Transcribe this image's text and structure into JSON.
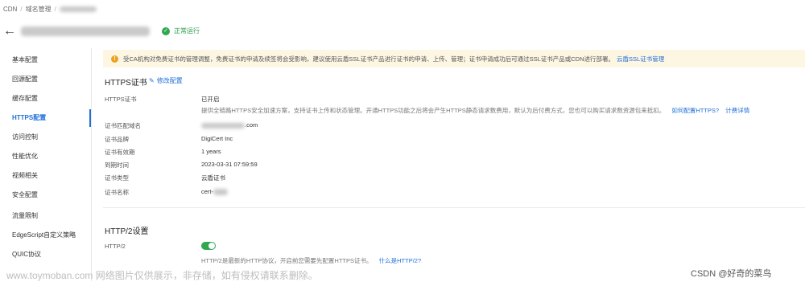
{
  "breadcrumb": {
    "root": "CDN",
    "sep": "/",
    "level1": "域名管理",
    "sep2": "/"
  },
  "header": {
    "status": "正常运行"
  },
  "sidebar": {
    "items": [
      {
        "label": "基本配置"
      },
      {
        "label": "回源配置"
      },
      {
        "label": "缓存配置"
      },
      {
        "label": "HTTPS配置"
      },
      {
        "label": "访问控制"
      },
      {
        "label": "性能优化"
      },
      {
        "label": "视频相关"
      },
      {
        "label": "安全配置"
      },
      {
        "label": "流量限制"
      },
      {
        "label": "EdgeScript自定义策略"
      },
      {
        "label": "QUIC协议"
      }
    ],
    "active_index": 3
  },
  "notice": {
    "text": "受CA机构对免费证书的管理调整，免费证书的申请及续签将会受影响，建议使用云盾SSL证书产品进行证书的申请、上传、管理；证书申请成功后可通过SSL证书产品或CDN进行部署。",
    "link": "云盾SSL证书管理",
    "accent": "#f0a020"
  },
  "https": {
    "title": "HTTPS证书",
    "edit_label": "修改配置",
    "cert_label": "HTTPS证书",
    "cert_value": "已开启",
    "cert_desc": "提供全链路HTTPS安全加速方案，支持证书上传和状态管理。开通HTTPS功能之后将会产生HTTPS静态请求数费用，默认为后付费方式，您也可以购买请求数资源包来抵扣。",
    "cert_link1": "如何配置HTTPS?",
    "cert_link2": "计费详情",
    "fields": [
      {
        "label": "证书匹配域名",
        "value": ".com"
      },
      {
        "label": "证书品牌",
        "value": "DigiCert Inc"
      },
      {
        "label": "证书有效期",
        "value": "1 years"
      },
      {
        "label": "到期时间",
        "value": "2023-03-31 07:59:59"
      },
      {
        "label": "证书类型",
        "value": "云盾证书"
      },
      {
        "label": "证书名称",
        "value": "cert-"
      }
    ]
  },
  "http2": {
    "title": "HTTP/2设置",
    "label": "HTTP/2",
    "enabled": true,
    "desc": "HTTP/2是最新的HTTP协议，开启前您需要先配置HTTPS证书。",
    "link": "什么是HTTP/2?"
  },
  "watermark": {
    "left": "www.toymoban.com 网络图片仅供展示，非存储，如有侵权请联系删除。",
    "right": "CSDN @好奇的菜鸟"
  },
  "colors": {
    "brand": "#1f6fd8",
    "success": "#2fa850",
    "notice_bg": "#fdf6e3"
  }
}
